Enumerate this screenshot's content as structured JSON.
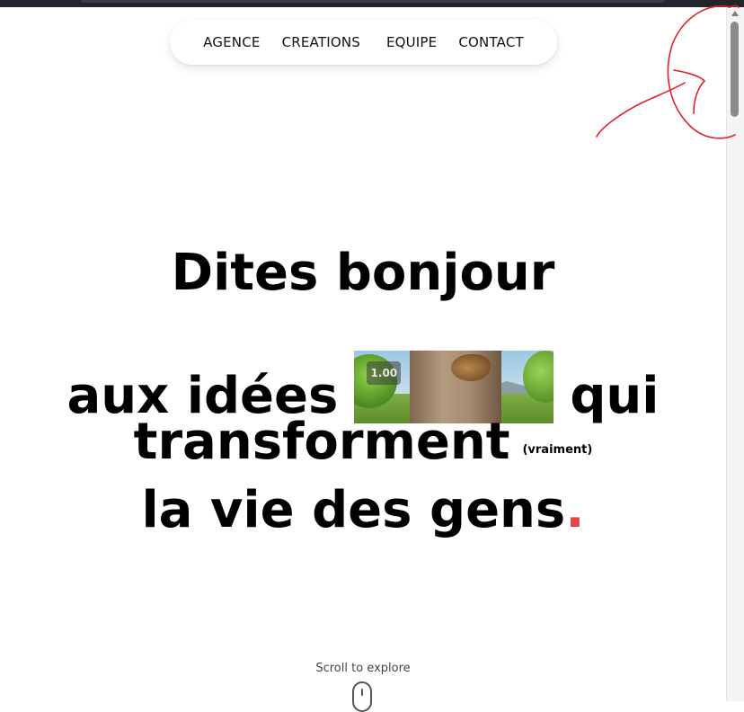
{
  "nav": {
    "items": [
      {
        "label": "AGENCE"
      },
      {
        "label": "CREATIONS "
      },
      {
        "label": "EQUIPE"
      },
      {
        "label": "CONTACT"
      }
    ]
  },
  "hero": {
    "line1": "Dites bonjour",
    "line2_before": "aux idées",
    "line2_after": "qui",
    "line3": "transforment",
    "line3_aside": "(vraiment)",
    "line4": "la vie des gens",
    "line4_dot": ".",
    "video_badge": "1.00"
  },
  "scroll_hint": "Scroll to explore",
  "colors": {
    "accent": "#ea4141",
    "annotation": "#e0202a"
  },
  "icons": {
    "scroll": "mouse-icon",
    "scrollbar_up": "arrow-up-icon"
  }
}
